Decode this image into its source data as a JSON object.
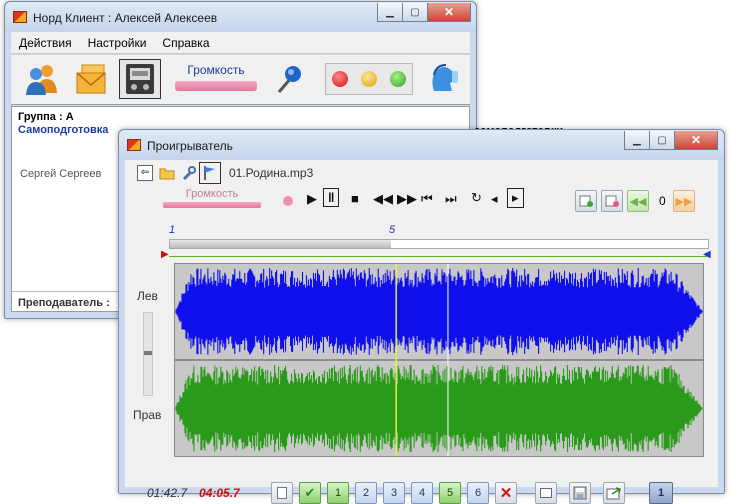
{
  "client_window": {
    "title": "Норд Клиент : Алексей Алексеев",
    "menu": [
      "Действия",
      "Настройки",
      "Справка"
    ],
    "toolbar": {
      "volume_label": "Громкость",
      "icons": [
        "users-icon",
        "mail-icon",
        "recorder-icon",
        "microphone-icon",
        "traffic-lights-icon",
        "headset-icon"
      ]
    },
    "group_label": "Группа : А",
    "group_activity": "Самоподготовка",
    "student_name": "Сергей Сергеев",
    "teacher_label": "Преподаватель :",
    "peek_text": "самоподготовки"
  },
  "player_window": {
    "title": "Проигрыватель",
    "filename": "01.Родина.mp3",
    "volume_label": "Громкость",
    "counter": "0",
    "ruler": {
      "start": "1",
      "marker": "5"
    },
    "channel_left": "Лев",
    "channel_right": "Прав",
    "time_current": "01:42.7",
    "time_total": "04:05.7",
    "tracks": [
      "1",
      "2",
      "3",
      "4",
      "5",
      "6"
    ],
    "track_badge": "1",
    "colors": {
      "left_channel": "#1010ee",
      "right_channel": "#2a9a1a",
      "time_total": "#cc1111"
    }
  }
}
